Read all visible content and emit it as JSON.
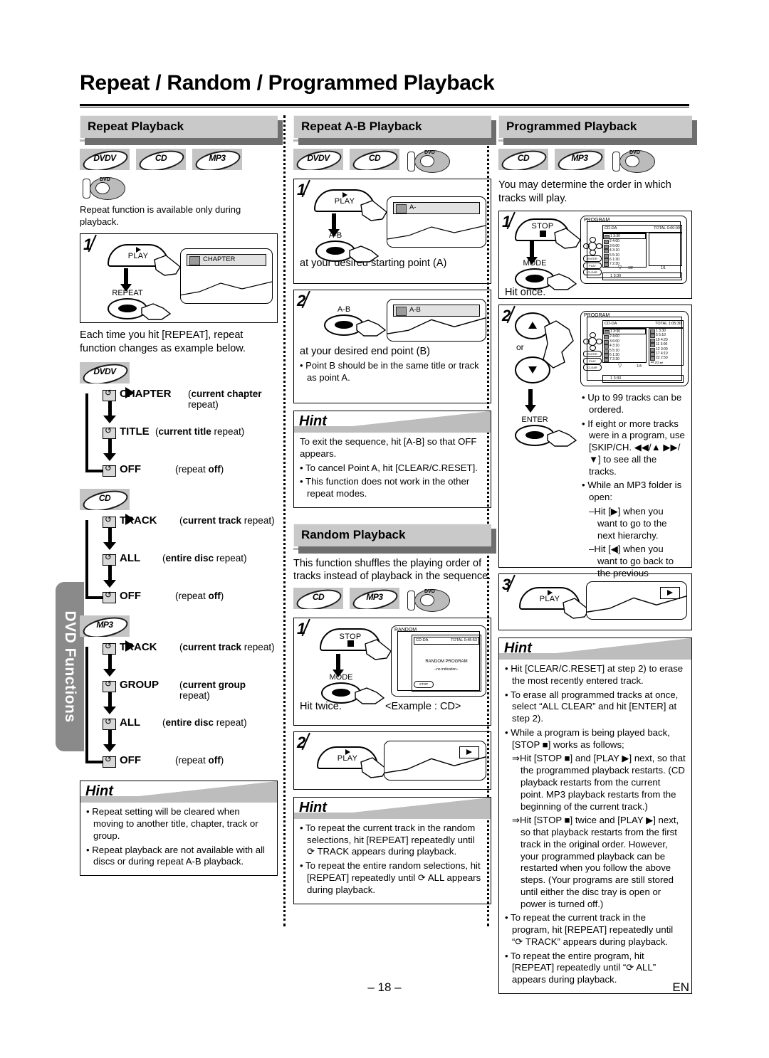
{
  "page": {
    "title": "Repeat / Random / Programmed Playback",
    "side_tab": "DVD Functions",
    "page_number": "– 18 –",
    "language": "EN"
  },
  "badges": {
    "dvdv": "DVDV",
    "cd": "CD",
    "mp3": "MP3",
    "dvd_disc": "DVD"
  },
  "col1": {
    "heading": "Repeat Playback",
    "intro": "Repeat function is available only during playback.",
    "step1": {
      "num": "1",
      "play_label": "PLAY",
      "repeat_label": "REPEAT",
      "osd_text": "CHAPTER"
    },
    "after_step": "Each time you hit [REPEAT], repeat function changes as example below.",
    "flow_dvdv": [
      {
        "label": "CHAPTER",
        "desc_b": "current chapter",
        "desc_t": " repeat"
      },
      {
        "label": "TITLE",
        "desc_b": "current title",
        "desc_t": " repeat"
      },
      {
        "label": "OFF",
        "desc_b": "off",
        "desc_t": "repeat "
      }
    ],
    "flow_cd": [
      {
        "label": "TRACK",
        "desc_b": "current track",
        "desc_t": " repeat"
      },
      {
        "label": "ALL",
        "desc_b": "entire disc",
        "desc_t": " repeat"
      },
      {
        "label": "OFF",
        "desc_b": "off",
        "desc_t": "repeat "
      }
    ],
    "flow_mp3": [
      {
        "label": "TRACK",
        "desc_b": "current track",
        "desc_t": " repeat"
      },
      {
        "label": "GROUP",
        "desc_b": "current group",
        "desc_t": " repeat"
      },
      {
        "label": "ALL",
        "desc_b": "entire disc",
        "desc_t": " repeat"
      },
      {
        "label": "OFF",
        "desc_b": "off",
        "desc_t": "repeat "
      }
    ],
    "hint": {
      "title": "Hint",
      "items": [
        "Repeat setting will be cleared when moving to another title, chapter, track or group.",
        "Repeat playback are not available with all discs or during repeat A-B playback."
      ]
    }
  },
  "col2": {
    "heading": "Repeat A-B Playback",
    "step1": {
      "num": "1",
      "play_label": "PLAY",
      "ab_label": "A-B",
      "osd_text": "A-",
      "caption": "at your desired starting point (A)"
    },
    "step2": {
      "num": "2",
      "ab_label": "A-B",
      "osd_text": "A-B",
      "caption": "at your desired end point (B)",
      "bullet": "Point B should be in the same title or track as point A."
    },
    "hint": {
      "title": "Hint",
      "items": [
        "To exit the sequence, hit [A-B] so that OFF appears.",
        "To cancel Point A, hit [CLEAR/C.RESET].",
        "This function does not work in the other repeat modes."
      ]
    },
    "random": {
      "heading": "Random Playback",
      "intro": "This function shuffles the playing order of tracks instead of playback in the sequence.",
      "step1": {
        "num": "1",
        "stop_label": "STOP",
        "mode_label": "MODE",
        "caption_left": "Hit twice.",
        "caption_right": "<Example : CD>",
        "osd": {
          "title": "RANDOM",
          "disc": "CD-DA",
          "total": "TOTAL 0:45:53",
          "line1": "RANDOM PROGRAM",
          "line2": "–no indication–",
          "pill": "STOP"
        }
      },
      "step2": {
        "num": "2",
        "play_label": "PLAY"
      },
      "hint": {
        "title": "Hint",
        "items": [
          "To repeat the current track in the random selections, hit [REPEAT] repeatedly until ⟳ TRACK appears during playback.",
          "To repeat the entire random selections, hit [REPEAT] repeatedly until ⟳ ALL appears during playback."
        ]
      }
    }
  },
  "col3": {
    "heading": "Programmed Playback",
    "intro": "You may determine the order in which tracks will play.",
    "step1": {
      "num": "1",
      "stop_label": "STOP",
      "mode_label": "MODE",
      "caption": "Hit once.",
      "osd": {
        "title": "PROGRAM",
        "disc": "CD-DA",
        "total": "TOTAL 0:00:00",
        "tracks": [
          "1  3:30",
          "2  4:00",
          "3  6:00",
          "4  3:10",
          "5  5:10",
          "6  1:30",
          "7  2:30"
        ],
        "page_left": "1/2",
        "page_right": "1/1",
        "footer": "1  3:30",
        "pill1": "ENTER",
        "pill2": "PLAY",
        "pill3": "CLEAR"
      }
    },
    "step2": {
      "num": "2",
      "or_label": "or",
      "enter_label": "ENTER",
      "osd": {
        "title": "PROGRAM",
        "disc": "CD-DA",
        "total": "TOTAL 1:05:30",
        "tracks_left": [
          "1  3:30",
          "2  4:00",
          "3  6:00",
          "4  3:10",
          "5  5:10",
          "6  1:30",
          "7  2:30"
        ],
        "tracks_right": [
          "1  3:30",
          "5  5:10",
          "10  4:20",
          "11  3:00",
          "12  3:00",
          "17  4:10",
          "22  2:50"
        ],
        "page_left": "1/4",
        "page_right": "2/3",
        "footer": "1  3:30"
      },
      "bullets": [
        "Up to 99 tracks can be ordered.",
        "If eight or more tracks were in a program, use [SKIP/CH. ◀◀/▲  ▶▶/▼] to see all the tracks.",
        "While an MP3 folder is open:",
        "–Hit [▶] when you want to go to the next hierarchy.",
        "–Hit [◀] when you want to go back to the previous hierarchy (except for the top hierarchy)."
      ]
    },
    "step3": {
      "num": "3",
      "play_label": "PLAY"
    },
    "hint": {
      "title": "Hint",
      "items": [
        "Hit [CLEAR/C.RESET] at step 2) to erase the most recently entered track.",
        "To erase all programmed tracks at once, select “ALL CLEAR” and hit [ENTER] at step 2).",
        "While a program is being played back, [STOP ■] works as follows;",
        "⇒Hit [STOP ■] and [PLAY ▶] next, so that the programmed playback restarts. (CD playback restarts from the current point. MP3 playback restarts from the beginning of the current track.)",
        "⇒Hit [STOP ■] twice and [PLAY ▶] next, so that playback restarts from the first track in the original order. However, your programmed playback can be restarted when you follow the above steps. (Your programs are still stored until either the disc tray is open or power is turned off.)",
        "To repeat the current track in the program, hit [REPEAT] repeatedly until “⟳ TRACK” appears during playback.",
        "To repeat the entire program, hit [REPEAT] repeatedly until “⟳ ALL” appears during playback."
      ]
    }
  }
}
